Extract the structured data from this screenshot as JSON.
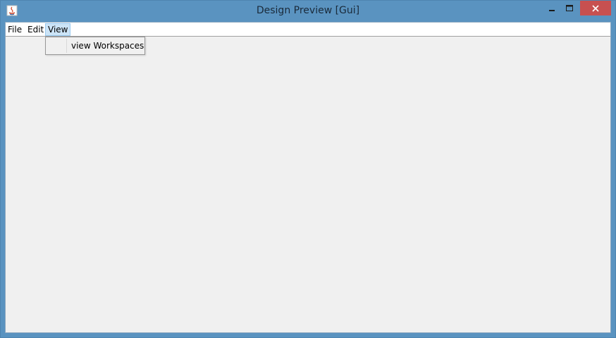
{
  "window": {
    "title": "Design Preview [Gui]",
    "controls": {
      "minimize_icon": "minimize-icon",
      "maximize_icon": "maximize-icon",
      "close_icon": "close-icon"
    }
  },
  "menubar": {
    "items": [
      {
        "label": "File"
      },
      {
        "label": "Edit"
      },
      {
        "label": "View",
        "active": true
      }
    ]
  },
  "view_menu": {
    "items": [
      {
        "label": "view Workspaces"
      }
    ]
  },
  "colors": {
    "titlebar": "#5a93c0",
    "close_button": "#c75050",
    "active_menu": "#cce4f7",
    "client_background": "#f0f0f0"
  }
}
